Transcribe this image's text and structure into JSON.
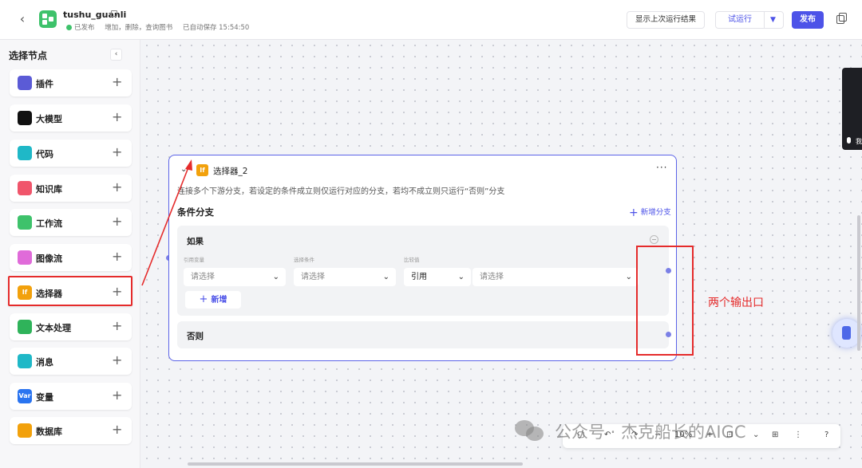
{
  "header": {
    "app_name": "tushu_guanli",
    "status": "已发布",
    "description": "增加，删除，查询图书",
    "autosave": "已自动保存 15:54:50",
    "btn_last_run": "显示上次运行结果",
    "btn_test_run": "试运行",
    "btn_publish": "发布"
  },
  "sidebar": {
    "title": "选择节点",
    "nodes": [
      {
        "label": "插件",
        "color": "#5b5bd6",
        "icon": "plugin-icon"
      },
      {
        "label": "大模型",
        "color": "#111111",
        "icon": "llm-icon"
      },
      {
        "label": "代码",
        "color": "#1fb8c7",
        "icon": "code-icon"
      },
      {
        "label": "知识库",
        "color": "#f0556b",
        "icon": "knowledge-icon"
      },
      {
        "label": "工作流",
        "color": "#3ec26b",
        "icon": "workflow-icon"
      },
      {
        "label": "图像流",
        "color": "#e06bd9",
        "icon": "image-flow-icon"
      },
      {
        "label": "选择器",
        "color": "#f2a10c",
        "icon": "if-icon"
      },
      {
        "label": "文本处理",
        "color": "#2fb35a",
        "icon": "text-icon"
      },
      {
        "label": "消息",
        "color": "#1fb8c7",
        "icon": "message-icon"
      },
      {
        "label": "变量",
        "color": "#2a74f0",
        "icon": "variable-icon"
      },
      {
        "label": "数据库",
        "color": "#f2a10c",
        "icon": "database-icon"
      }
    ],
    "icon_text": {
      "if": "If",
      "var": "Var"
    }
  },
  "card": {
    "title": "选择器_2",
    "description": "连接多个下游分支，若设定的条件成立则仅运行对应的分支，若均不成立则只运行“否则”分支",
    "section": "条件分支",
    "add_branch": "新增分支",
    "if_branch": {
      "title": "如果",
      "col_labels": [
        "引用变量",
        "选择条件",
        "比较值"
      ],
      "select_placeholder_1": "请选择",
      "select_placeholder_2": "请选择",
      "compare_type": "引用",
      "select_placeholder_3": "请选择",
      "add_label": "新增"
    },
    "else_branch": {
      "title": "否则"
    }
  },
  "annotation": {
    "label": "两个输出口",
    "color": "#e52b2b"
  },
  "dark_panel_text": "我",
  "toolbar": {
    "zoom": "10%"
  },
  "watermark": "公众号 · 杰克船长的AIGC"
}
